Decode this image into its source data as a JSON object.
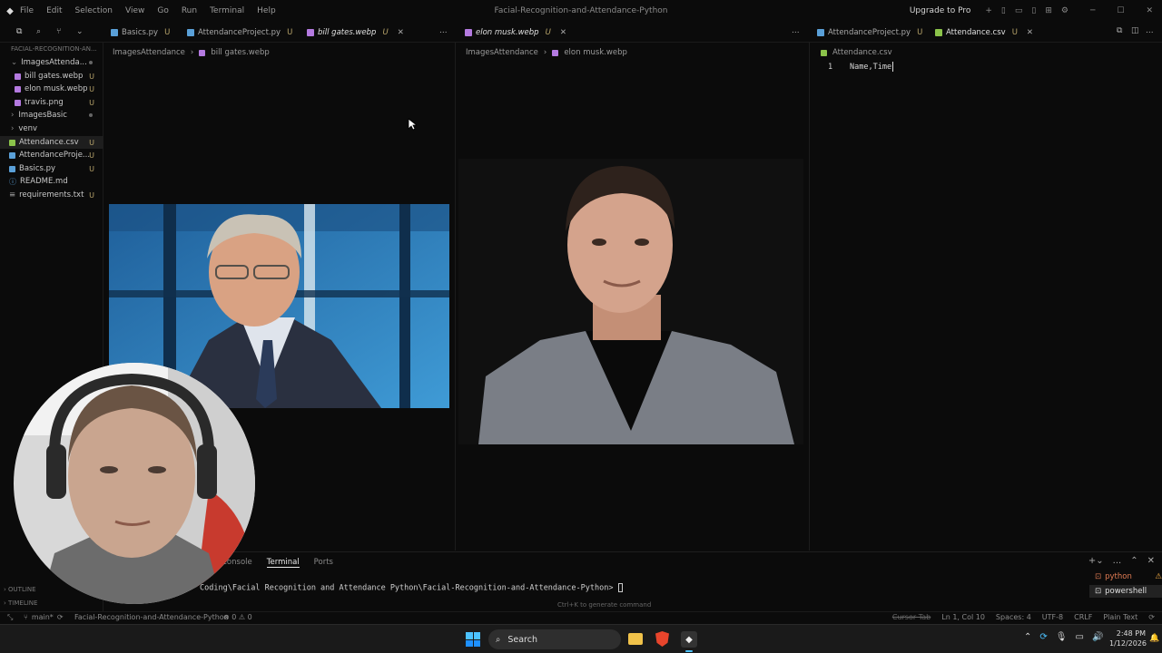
{
  "window": {
    "title": "Facial-Recognition-and-Attendance-Python",
    "upgrade": "Upgrade to Pro"
  },
  "menu": [
    "File",
    "Edit",
    "Selection",
    "View",
    "Go",
    "Run",
    "Terminal",
    "Help"
  ],
  "tabs": {
    "group1": [
      {
        "label": "Basics.py",
        "status": "U"
      },
      {
        "label": "AttendanceProject.py",
        "status": "U"
      },
      {
        "label": "bill gates.webp",
        "status": "U"
      }
    ],
    "group2": [
      {
        "label": "elon musk.webp",
        "status": "U"
      }
    ],
    "group3": [
      {
        "label": "AttendanceProject.py",
        "status": "U"
      },
      {
        "label": "Attendance.csv",
        "status": "U"
      }
    ],
    "more": "..."
  },
  "sidebar": {
    "root": "FACIAL-RECOGNITION-AN...",
    "items": [
      {
        "label": "ImagesAttenda...",
        "status": "",
        "kind": "folder-open"
      },
      {
        "label": "bill gates.webp",
        "status": "U",
        "kind": "image"
      },
      {
        "label": "elon musk.webp",
        "status": "U",
        "kind": "image"
      },
      {
        "label": "travis.png",
        "status": "U",
        "kind": "image"
      },
      {
        "label": "ImagesBasic",
        "status": "",
        "kind": "folder"
      },
      {
        "label": "venv",
        "status": "",
        "kind": "folder"
      },
      {
        "label": "Attendance.csv",
        "status": "U",
        "kind": "csv"
      },
      {
        "label": "AttendanceProje...",
        "status": "U",
        "kind": "py"
      },
      {
        "label": "Basics.py",
        "status": "U",
        "kind": "py"
      },
      {
        "label": "README.md",
        "status": "",
        "kind": "md"
      },
      {
        "label": "requirements.txt",
        "status": "U",
        "kind": "txt"
      }
    ],
    "outline": "OUTLINE",
    "timeline": "TIMELINE"
  },
  "breadcrumbs": {
    "editor1": {
      "folder": "ImagesAttendance",
      "file": "bill gates.webp"
    },
    "editor2": {
      "folder": "ImagesAttendance",
      "file": "elon musk.webp"
    },
    "editor3": {
      "file": "Attendance.csv"
    }
  },
  "csv_editor": {
    "line_number": "1",
    "content": "Name,Time"
  },
  "panel": {
    "tabs": [
      "Console",
      "Terminal",
      "Ports"
    ],
    "active_tab": "Terminal",
    "prompt": "Coding\\Facial Recognition and Attendance Python\\Facial-Recognition-and-Attendance-Python>",
    "hint": "Ctrl+K to generate command",
    "terminals": [
      "python",
      "powershell"
    ]
  },
  "statusbar": {
    "branch": "main*",
    "project": "Facial-Recognition-and-Attendance-Python",
    "problems": "⊗ 0 ⚠ 0",
    "cursor_tab": "Cursor Tab",
    "position": "Ln 1, Col 10",
    "spaces": "Spaces: 4",
    "encoding": "UTF-8",
    "eol": "CRLF",
    "language": "Plain Text"
  },
  "taskbar": {
    "search": "Search",
    "time": "2:48 PM",
    "date": "1/12/2026"
  },
  "colors": {
    "accent": "#0078d4",
    "modified": "#b9a56b",
    "csv_icon": "#8bc34a",
    "py_icon": "#5aa0d8",
    "image_icon": "#b47ae0"
  }
}
